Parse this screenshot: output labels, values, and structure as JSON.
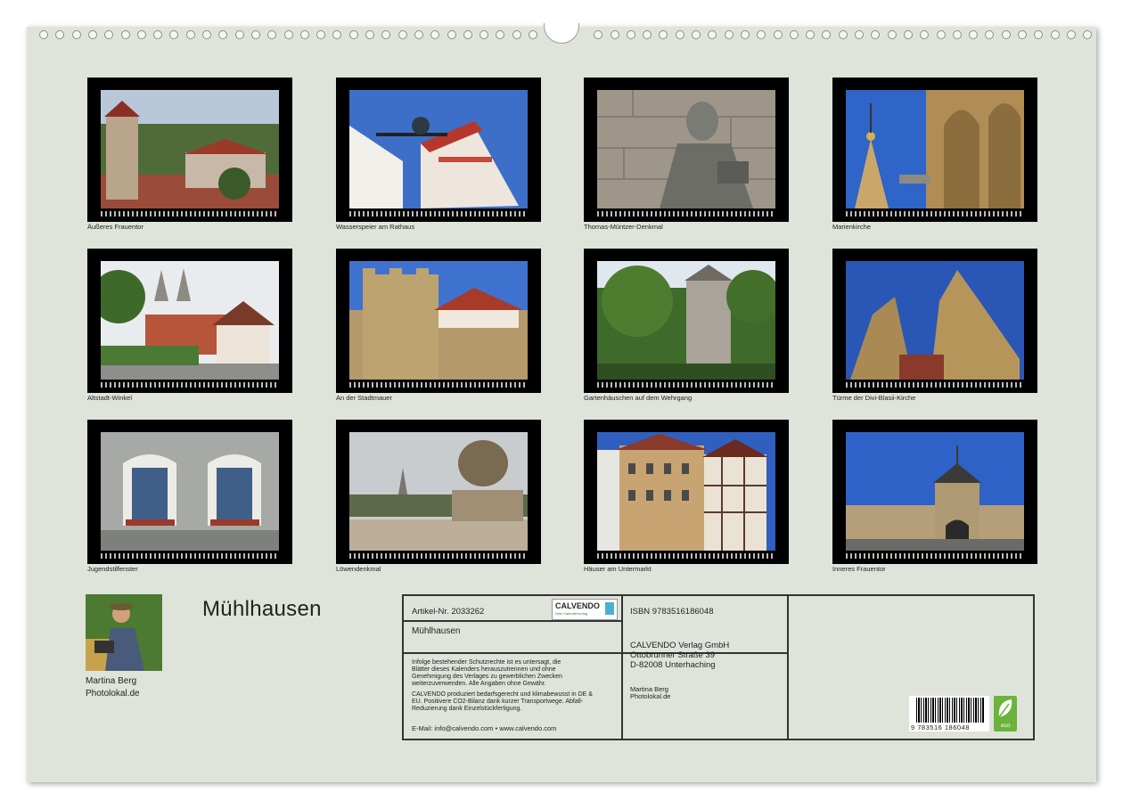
{
  "calendar": {
    "title": "Mühlhausen",
    "author_name": "Martina Berg",
    "author_site": "Photolokal.de"
  },
  "photos": [
    {
      "caption": "Äußeres Frauentor"
    },
    {
      "caption": "Wasserspeier am Rathaus"
    },
    {
      "caption": "Thomas-Müntzer-Denkmal"
    },
    {
      "caption": "Marienkirche"
    },
    {
      "caption": "Altstadt-Winkel"
    },
    {
      "caption": "An der Stadtmauer"
    },
    {
      "caption": "Gartenhäuschen auf dem Wehrgang"
    },
    {
      "caption": "Türme der Divi-Blasii-Kirche"
    },
    {
      "caption": "Jugendstilfenster"
    },
    {
      "caption": "Löwendenkmal"
    },
    {
      "caption": "Häuser am Untermarkt"
    },
    {
      "caption": "Inneres Frauentor"
    }
  ],
  "info": {
    "article": "Artikel-Nr. 2033262",
    "logo_text": "CALVENDO",
    "logo_subtext": "Dein Kalenderverlag",
    "title": "Mühlhausen",
    "legal_1": "Infolge bestehender Schutzrechte ist es untersagt, die",
    "legal_2": "Blätter dieses Kalenders herauszutrennen und ohne",
    "legal_3": "Genehmigung des Verlages zu gewerblichen Zwecken",
    "legal_4": "weiterzuverwenden. Alle Angaben ohne Gewähr.",
    "eco_1": "CALVENDO produziert bedarfsgerecht und klimabewusst in DE &",
    "eco_2": "EU. Positivere CO2-Bilanz dank kurzer Transportwege. Abfall-",
    "eco_3": "Reduzierung dank Einzelstückfertigung.",
    "contact": "E-Mail: info@calvendo.com • www.calvendo.com",
    "isbn": "ISBN 9783516186048",
    "publisher_1": "CALVENDO Verlag GmbH",
    "publisher_2": "Ottobrunner Straße 39",
    "publisher_3": "D-82008 Unterhaching",
    "author_name": "Martina Berg",
    "author_site": "Photolokal.de",
    "barcode_number": "9 783516 186048",
    "eco_label": "eco"
  }
}
